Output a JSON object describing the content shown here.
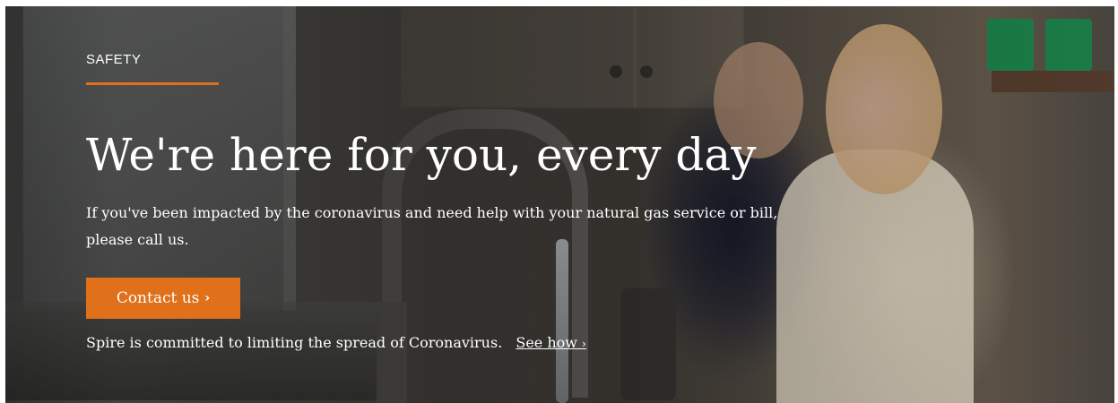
{
  "hero": {
    "eyebrow": "SAFETY",
    "headline": "We're here for you, every day",
    "lead": "If you've been impacted by the coronavirus and need help with your natural gas service or bill, please call us.",
    "cta_label": "Contact us",
    "cta_icon": "chevron-right-icon",
    "note_text": "Spire is committed to limiting the spread of Coronavirus.",
    "link_label": "See how",
    "link_icon": "chevron-right-icon"
  },
  "colors": {
    "accent": "#e0701a",
    "text": "#ffffff"
  }
}
